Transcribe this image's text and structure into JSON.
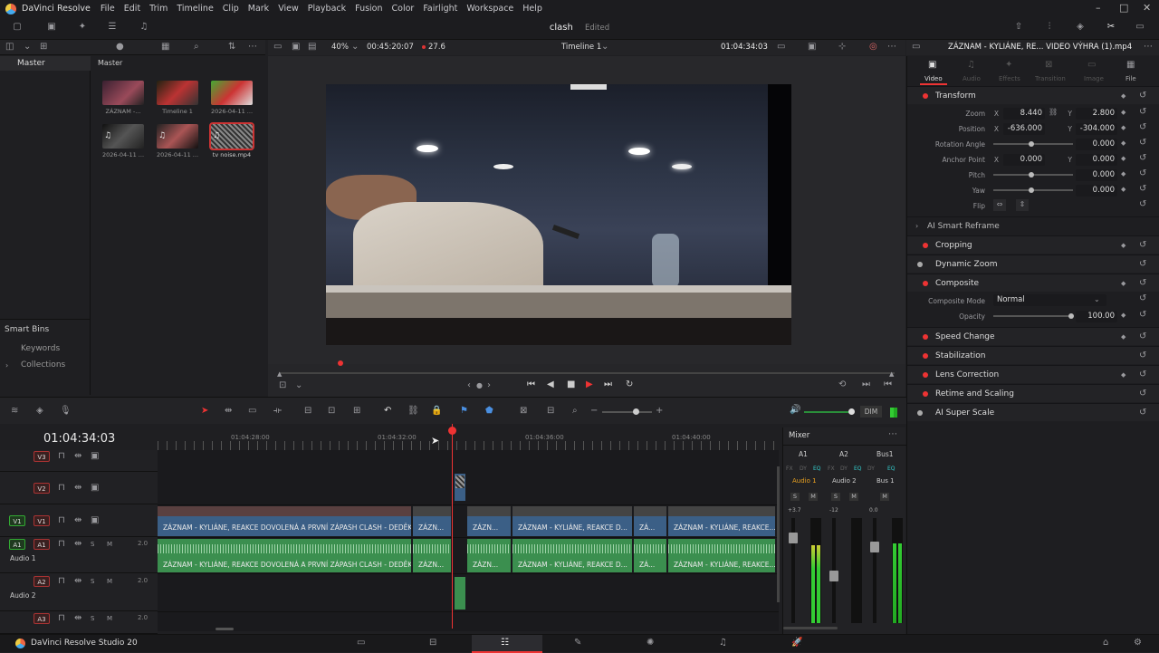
{
  "menu": {
    "app_name": "DaVinci Resolve",
    "items": [
      "File",
      "Edit",
      "Trim",
      "Timeline",
      "Clip",
      "Mark",
      "View",
      "Playback",
      "Fusion",
      "Color",
      "Fairlight",
      "Workspace",
      "Help"
    ]
  },
  "project": {
    "name": "clash",
    "status": "Edited"
  },
  "media": {
    "bin_title": "Master",
    "pool_title": "Master",
    "smart_bins": "Smart Bins",
    "smart_items": [
      "Keywords",
      "Collections"
    ],
    "clips": [
      {
        "label": "ZÁZNAM -..."
      },
      {
        "label": "Timeline 1"
      },
      {
        "label": "2026-04-11 ..."
      },
      {
        "label": "2026-04-11 ..."
      },
      {
        "label": "2026-04-11 ..."
      },
      {
        "label": "tv noise.mp4"
      }
    ]
  },
  "viewer": {
    "zoom": "40%",
    "duration": "00:45:20:07",
    "fps": "27.6",
    "timeline_name": "Timeline 1",
    "timecode": "01:04:34:03",
    "clip_name": "ZÁZNAM - KYLIÁNE, RE... VIDEO VÝHRA (1).mp4"
  },
  "inspector": {
    "tabs": [
      "Video",
      "Audio",
      "Effects",
      "Transition",
      "Image",
      "File"
    ],
    "transform": {
      "title": "Transform",
      "zoom_label": "Zoom",
      "zoom_x": "8.440",
      "zoom_y": "2.800",
      "pos_label": "Position",
      "pos_x": "-636.000",
      "pos_y": "-304.000",
      "rot_label": "Rotation Angle",
      "rot": "0.000",
      "anchor_label": "Anchor Point",
      "anchor_x": "0.000",
      "anchor_y": "0.000",
      "pitch_label": "Pitch",
      "pitch": "0.000",
      "yaw_label": "Yaw",
      "yaw": "0.000",
      "flip_label": "Flip",
      "x": "X",
      "y": "Y"
    },
    "sections": [
      "AI Smart Reframe",
      "Cropping",
      "Dynamic Zoom",
      "Composite",
      "Speed Change",
      "Stabilization",
      "Lens Correction",
      "Retime and Scaling",
      "AI Super Scale"
    ],
    "composite": {
      "mode_label": "Composite Mode",
      "mode": "Normal",
      "opacity_label": "Opacity",
      "opacity": "100.00"
    }
  },
  "timeline": {
    "timecode": "01:04:34:03",
    "ruler": [
      "01:04:28:00",
      "01:04:32:00",
      "01:04:36:00",
      "01:04:40:00"
    ],
    "tracks": {
      "v3": "V3",
      "v2": "V2",
      "v1": "V1",
      "a1": "A1",
      "a2": "A2",
      "a3": "A3",
      "audio1": "Audio 1",
      "audio2": "Audio 2",
      "vol1": "2.0",
      "vol2": "2.0",
      "vol3": "2.0",
      "s": "S",
      "m": "M"
    },
    "clip_full": "ZÁZNAM - KYLIÁNE, REAKCE DOVOLENÁ A PRVNÍ ZÁPASH CLASH - DEDĚK ...",
    "clip_short1": "ZÁZN...",
    "clip_short2": "ZÁZN...",
    "clip_mid": "ZÁZNAM - KYLIÁNE, REAKCE D...",
    "clip_tiny": "ZÁ...",
    "clip_end": "ZÁZNAM - KYLIÁNE, REAKCE..."
  },
  "mixer": {
    "title": "Mixer",
    "channels": [
      "A1",
      "A2",
      "Bus1"
    ],
    "names": [
      "Audio 1",
      "Audio 2",
      "Bus 1"
    ],
    "fx": [
      "FX",
      "DY",
      "EQ"
    ],
    "s": "S",
    "m": "M",
    "levels": [
      "+3.7",
      "-12",
      "0.0"
    ],
    "scale": [
      "0",
      "-5",
      "-10",
      "-15",
      "-20",
      "-30",
      "-40",
      "-50"
    ],
    "dim": "DIM"
  },
  "footer": {
    "app": "DaVinci Resolve Studio 20"
  }
}
